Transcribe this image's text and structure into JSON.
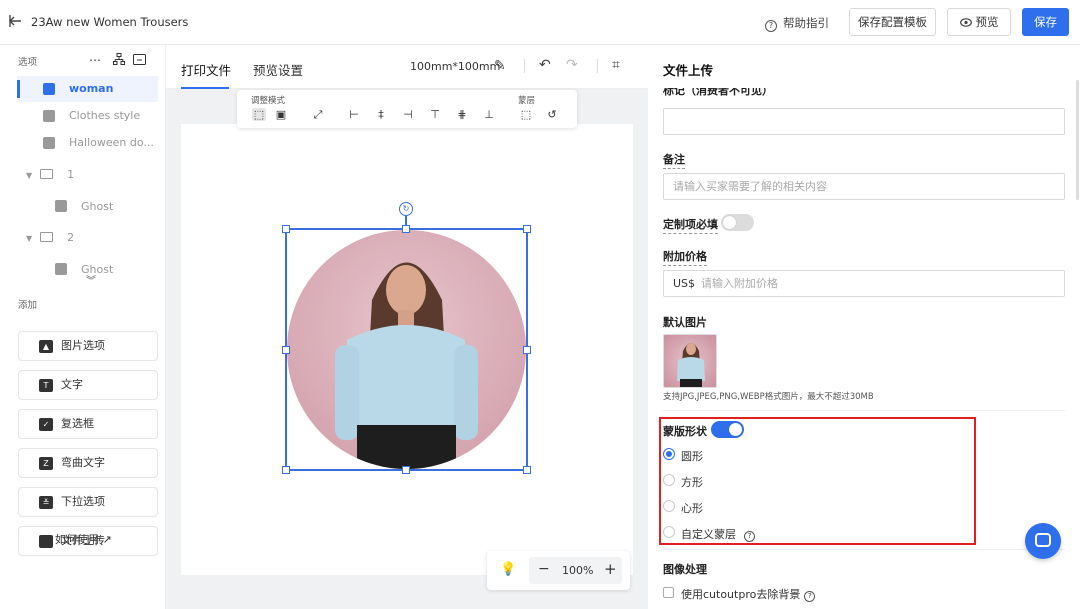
{
  "app": {
    "title": "23Aw new Women Trousers"
  },
  "header": {
    "help_label": "帮助指引",
    "save_template_label": "保存配置模板",
    "preview_label": "预览",
    "save_label": "保存"
  },
  "left": {
    "options_label": "选项",
    "tree": [
      {
        "label": "woman",
        "active": true
      },
      {
        "label": "Clothes style"
      },
      {
        "label": "Halloween do..."
      }
    ],
    "groups": [
      {
        "label": "1",
        "child": "Ghost"
      },
      {
        "label": "2",
        "child": "Ghost"
      }
    ],
    "add_label": "添加",
    "add_items": [
      "图片选项",
      "文字",
      "复选框",
      "弯曲文字",
      "下拉选项",
      "文件上传"
    ],
    "howto_label": "如何使用"
  },
  "center": {
    "tabs": [
      "打印文件",
      "预览设置"
    ],
    "size": "100mm*100mm",
    "toolbar": {
      "mode_label": "调整模式",
      "mask_label": "蒙层"
    },
    "zoom": "100%"
  },
  "right": {
    "title": "文件上传",
    "cut_label": "标记（消费者不可见）",
    "note_label": "备注",
    "note_placeholder": "请输入买家需要了解的相关内容",
    "required_label": "定制项必填",
    "required_on": false,
    "price_label": "附加价格",
    "price_prefix": "US$",
    "price_placeholder": "请输入附加价格",
    "default_image_label": "默认图片",
    "image_hint": "支持JPG,JPEG,PNG,WEBP格式图片，最大不超过30MB",
    "mask_shape_label": "蒙版形状",
    "mask_on": true,
    "shapes": [
      "圆形",
      "方形",
      "心形",
      "自定义蒙层"
    ],
    "selected_shape": "圆形",
    "image_processing_label": "图像处理",
    "cutout_label": "使用cutoutpro去除背景"
  },
  "colors": {
    "accent": "#2f6fed",
    "highlight": "#e02020"
  }
}
